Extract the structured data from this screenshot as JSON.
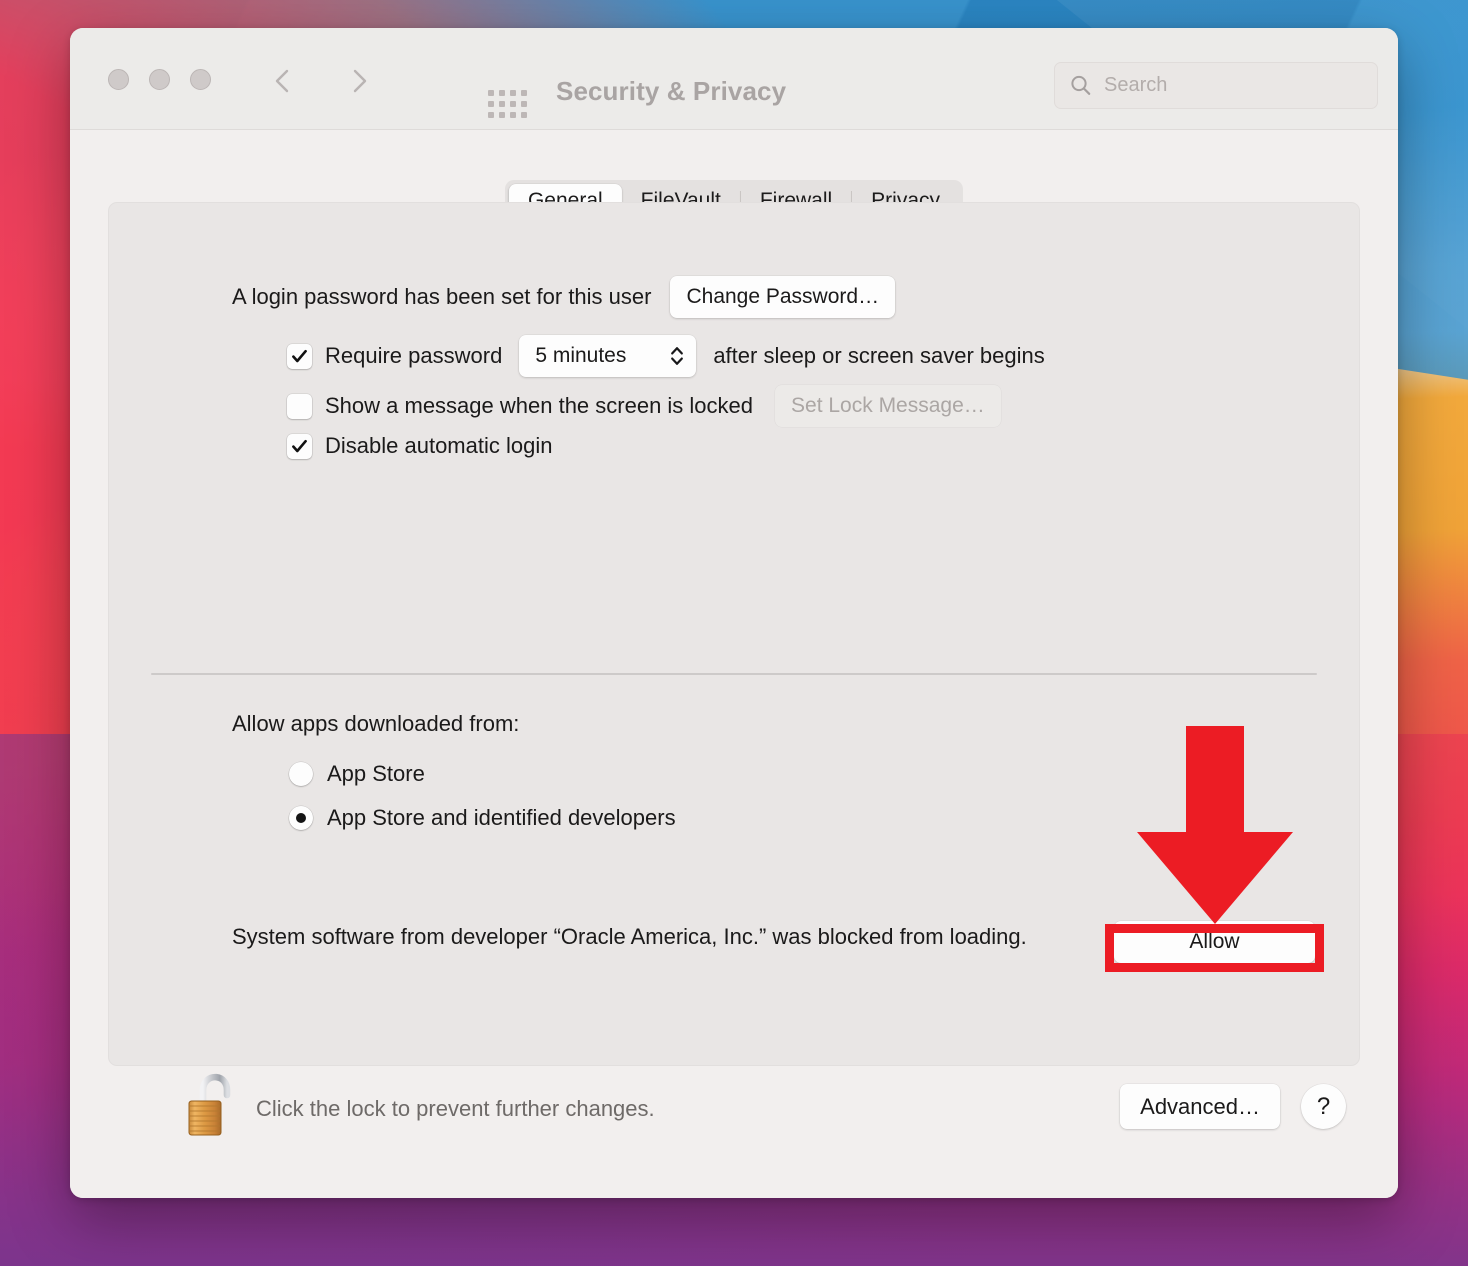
{
  "window": {
    "title": "Security & Privacy",
    "traffic_lights": [
      "close",
      "minimize",
      "zoom"
    ],
    "nav": {
      "back": "back",
      "forward": "forward"
    },
    "grid_icon": "show-all-grid-icon",
    "search": {
      "placeholder": "Search",
      "value": "",
      "icon": "search-icon"
    }
  },
  "tabs": [
    {
      "label": "General",
      "selected": true
    },
    {
      "label": "FileVault",
      "selected": false
    },
    {
      "label": "Firewall",
      "selected": false
    },
    {
      "label": "Privacy",
      "selected": false
    }
  ],
  "general": {
    "login_password_text": "A login password has been set for this user",
    "change_password_label": "Change Password…",
    "require_password": {
      "label": "Require password",
      "checked": true,
      "interval_value": "5 minutes",
      "suffix": "after sleep or screen saver begins"
    },
    "show_message": {
      "label": "Show a message when the screen is locked",
      "checked": false,
      "set_lock_message_label": "Set Lock Message…",
      "set_lock_message_disabled": true
    },
    "disable_auto_login": {
      "label": "Disable automatic login",
      "checked": true
    }
  },
  "allow_apps": {
    "group_label": "Allow apps downloaded from:",
    "options": [
      {
        "label": "App Store",
        "selected": false
      },
      {
        "label": "App Store and identified developers",
        "selected": true
      }
    ],
    "blocked_message": "System software from developer “Oracle America, Inc.” was blocked from loading.",
    "allow_button_label": "Allow"
  },
  "footer": {
    "lock_icon": "unlocked-padlock-icon",
    "lock_text": "Click the lock to prevent further changes.",
    "advanced_label": "Advanced…",
    "help_label": "?"
  },
  "annotation": {
    "color": "#ec1c24",
    "arrow": "down-arrow-annotation",
    "target": "Allow"
  }
}
